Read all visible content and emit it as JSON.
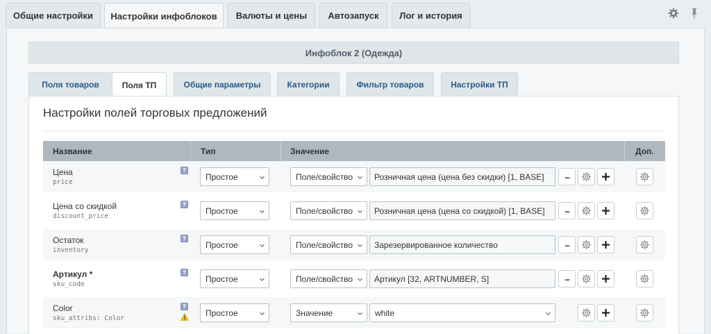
{
  "top_tabs": [
    {
      "label": "Общие настройки"
    },
    {
      "label": "Настройки инфоблоков",
      "active": true
    },
    {
      "label": "Валюты и цены"
    },
    {
      "label": "Автозапуск"
    },
    {
      "label": "Лог и история"
    }
  ],
  "iblock_title": "Инфоблок 2 (Одежда)",
  "sub_tabs": [
    {
      "label": "Поля товаров"
    },
    {
      "label": "Поля ТП",
      "active": true
    },
    {
      "label": "Общие параметры"
    },
    {
      "label": "Категории"
    },
    {
      "label": "Фильтр товаров"
    },
    {
      "label": "Настройки ТП"
    }
  ],
  "panel_title": "Настройки полей торговых предложений",
  "columns": {
    "name": "Название",
    "type": "Тип",
    "value": "Значение",
    "extra": "Доп."
  },
  "icons": {
    "settings": "gear-icon",
    "pin": "pin-icon",
    "help": "help-icon",
    "warning": "warning-icon",
    "more": "more-dots-icon",
    "add": "plus-icon",
    "dropdown": "chevron-down-icon"
  },
  "colors": {
    "header_bg": "#aeb8be",
    "link_tab": "#2a5a8a",
    "help_badge": "#9aa5c9",
    "warning": "#f2c300"
  },
  "rows": [
    {
      "name": "Цена",
      "code": "price",
      "type": "Простое",
      "source": "Поле/свойство",
      "value": "Розничная цена (цена без скидки) [1, BASE]",
      "help": "?"
    },
    {
      "name": "Цена со скидкой",
      "code": "discount_price",
      "type": "Простое",
      "source": "Поле/свойство",
      "value": "Розничная цена (цена со скидкой) [1, BASE]",
      "help": "?"
    },
    {
      "name": "Остаток",
      "code": "inventory",
      "type": "Простое",
      "source": "Поле/свойство",
      "value": "Зарезервированное количество",
      "help": "?"
    },
    {
      "name": "Артикул *",
      "code": "sku_code",
      "type": "Простое",
      "source": "Поле/свойство",
      "value": "Артикул [32, ARTNUMBER, S]",
      "help": "?"
    },
    {
      "name": "Color",
      "code": "sku_attribs: Color",
      "type": "Простое",
      "source": "Значение",
      "value": "white",
      "help": "?"
    }
  ]
}
